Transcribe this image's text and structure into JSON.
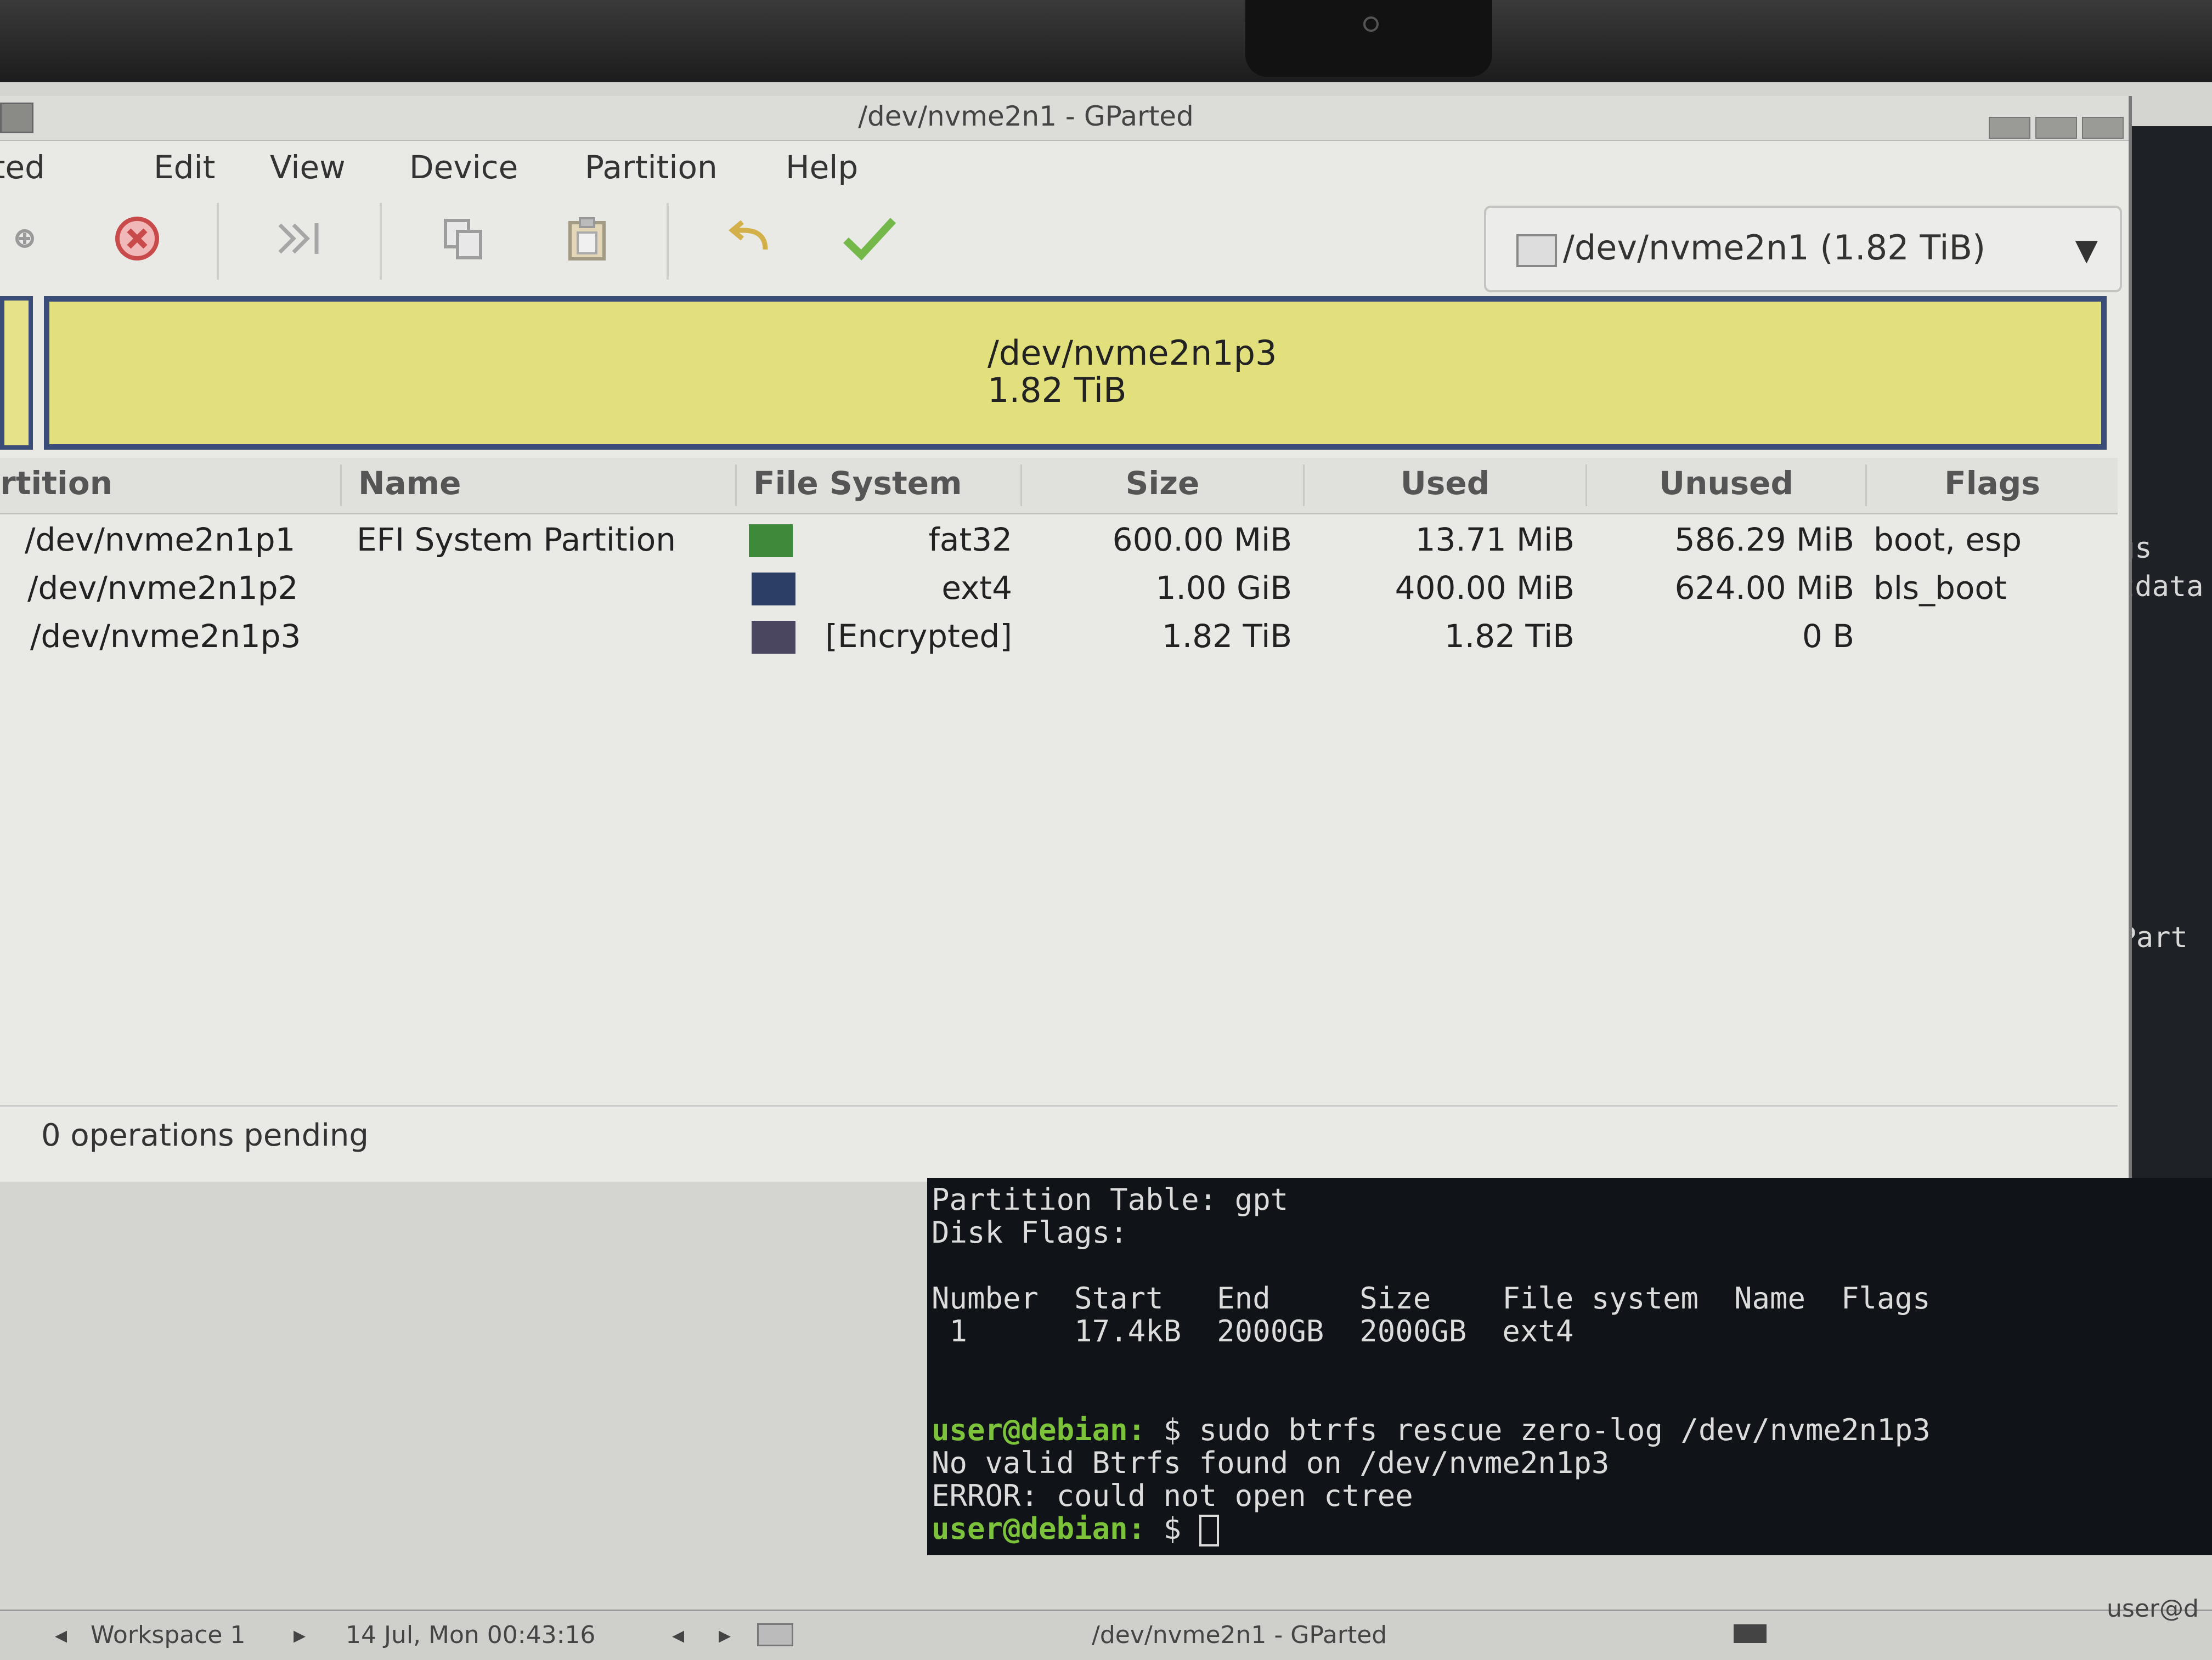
{
  "window": {
    "title": "/dev/nvme2n1 - GParted"
  },
  "menubar": [
    "GParted",
    "Edit",
    "View",
    "Device",
    "Partition",
    "Help"
  ],
  "toolbar": {
    "device_selector": "/dev/nvme2n1 (1.82 TiB)"
  },
  "disk_map": {
    "partition": "/dev/nvme2n1p3",
    "size": "1.82 TiB"
  },
  "table": {
    "headers": [
      "Partition",
      "Name",
      "File System",
      "Size",
      "Used",
      "Unused",
      "Flags"
    ],
    "rows": [
      {
        "partition": "/dev/nvme2n1p1",
        "name": "EFI System Partition",
        "fs_color": "#3d8a3a",
        "fs": "fat32",
        "size": "600.00 MiB",
        "used": "13.71 MiB",
        "unused": "586.29 MiB",
        "flags": "boot, esp"
      },
      {
        "partition": "/dev/nvme2n1p2",
        "name": "",
        "fs_color": "#2c3e63",
        "fs": "ext4",
        "size": "1.00 GiB",
        "used": "400.00 MiB",
        "unused": "624.00 MiB",
        "flags": "bls_boot"
      },
      {
        "partition": "/dev/nvme2n1p3",
        "name": "",
        "fs_color": "#4a4660",
        "fs": "[Encrypted]",
        "size": "1.82 TiB",
        "used": "1.82 TiB",
        "unused": "0 B",
        "flags": ""
      }
    ]
  },
  "status": "0 operations pending",
  "terminal": {
    "lines": [
      "Partition Table: gpt",
      "Disk Flags:",
      "",
      "Number  Start   End     Size    File system  Name  Flags",
      " 1      17.4kB  2000GB  2000GB  ext4"
    ],
    "prompt": "user@debian:",
    "command_line": " $ sudo btrfs rescue zero-log /dev/nvme2n1p3",
    "output": [
      "No valid Btrfs found on /dev/nvme2n1p3",
      "ERROR: could not open ctree"
    ],
    "prompt2_tail": " $ "
  },
  "background_terminal": {
    "fragments": [
      "gs",
      "tdata",
      "n Part"
    ]
  },
  "taskbar": {
    "workspace": "Workspace 1",
    "datetime": "14 Jul, Mon 00:43:16",
    "task": "/dev/nvme2n1 - GParted",
    "user": "user@d"
  },
  "colors": {
    "partition_map_fill": "#e2e07c",
    "partition_map_border": "#3a4c78",
    "prompt": "#7cc23a"
  }
}
